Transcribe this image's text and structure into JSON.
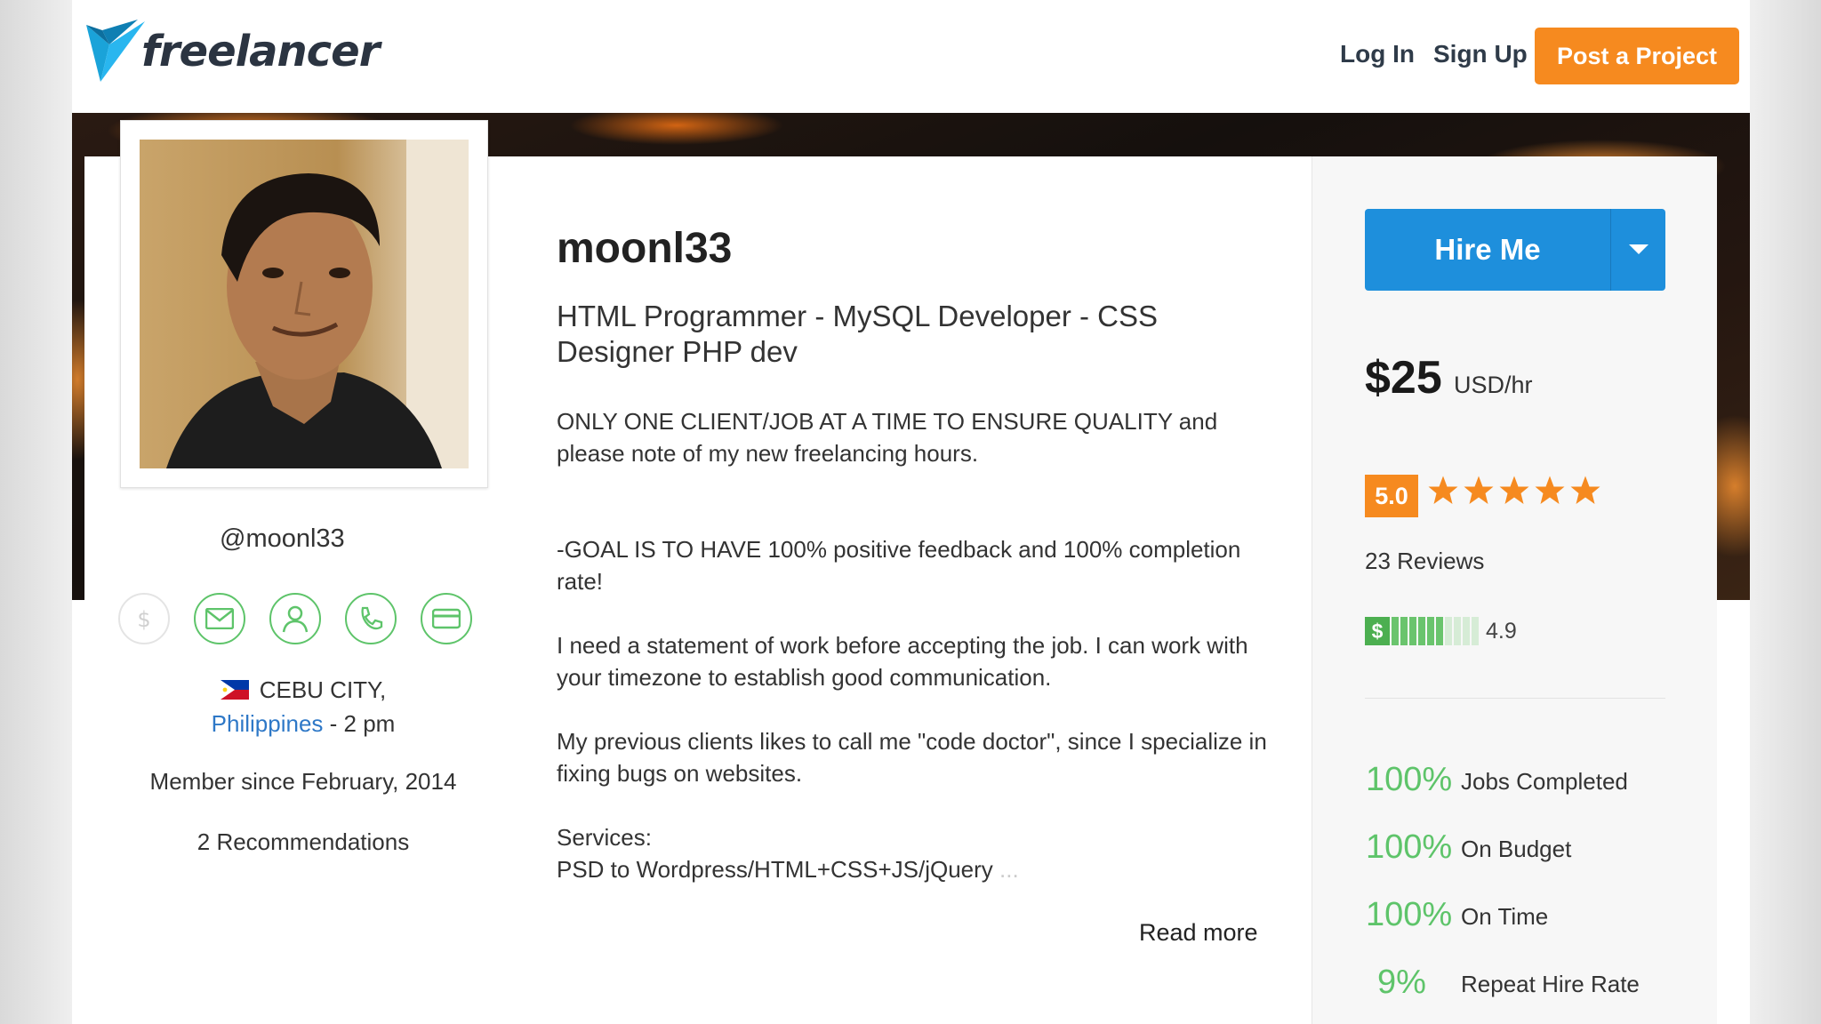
{
  "header": {
    "logo_text": "freelancer",
    "login_label": "Log In",
    "signup_label": "Sign Up",
    "post_project_label": "Post a Project"
  },
  "profile": {
    "handle": "@moonl33",
    "username": "moonl33",
    "tagline": "HTML Programmer - MySQL Developer - CSS Designer PHP dev",
    "city": "CEBU CITY,",
    "country": "Philippines",
    "local_time": "- 2 pm",
    "member_since": "Member since February, 2014",
    "recommendations": "2 Recommendations",
    "contact_icons": [
      "dollar-icon",
      "email-icon",
      "user-icon",
      "phone-icon",
      "card-icon"
    ]
  },
  "description": {
    "p1": "ONLY ONE CLIENT/JOB AT A TIME TO ENSURE QUALITY and please note of my new freelancing hours.",
    "p2": "-GOAL IS TO HAVE 100% positive feedback and 100% completion rate!",
    "p3": "I need a statement of work before accepting the job. I can work with your timezone to establish good communication.",
    "p4": "My previous clients likes to call me \"code doctor\", since I specialize in  fixing bugs on websites.",
    "services_label": "Services:",
    "services_text": "PSD to Wordpress/HTML+CSS+JS/jQuery",
    "ellipsis": "...",
    "read_more": "Read more"
  },
  "sidebar": {
    "hire_label": "Hire Me",
    "rate": "$25",
    "rate_unit": "USD/hr",
    "rating": "5.0",
    "stars": 5,
    "reviews": "23 Reviews",
    "earnings_score": "4.9",
    "earnings_fraction": 0.6,
    "stats": [
      {
        "pct": "100%",
        "label": "Jobs Completed"
      },
      {
        "pct": "100%",
        "label": "On Budget"
      },
      {
        "pct": "100%",
        "label": "On Time"
      },
      {
        "pct": "9%",
        "label": "Repeat Hire Rate"
      }
    ]
  },
  "colors": {
    "accent_orange": "#f68a1f",
    "hire_blue": "#1e8fdc",
    "stat_green": "#5ec46a",
    "link_blue": "#2e78c7"
  }
}
